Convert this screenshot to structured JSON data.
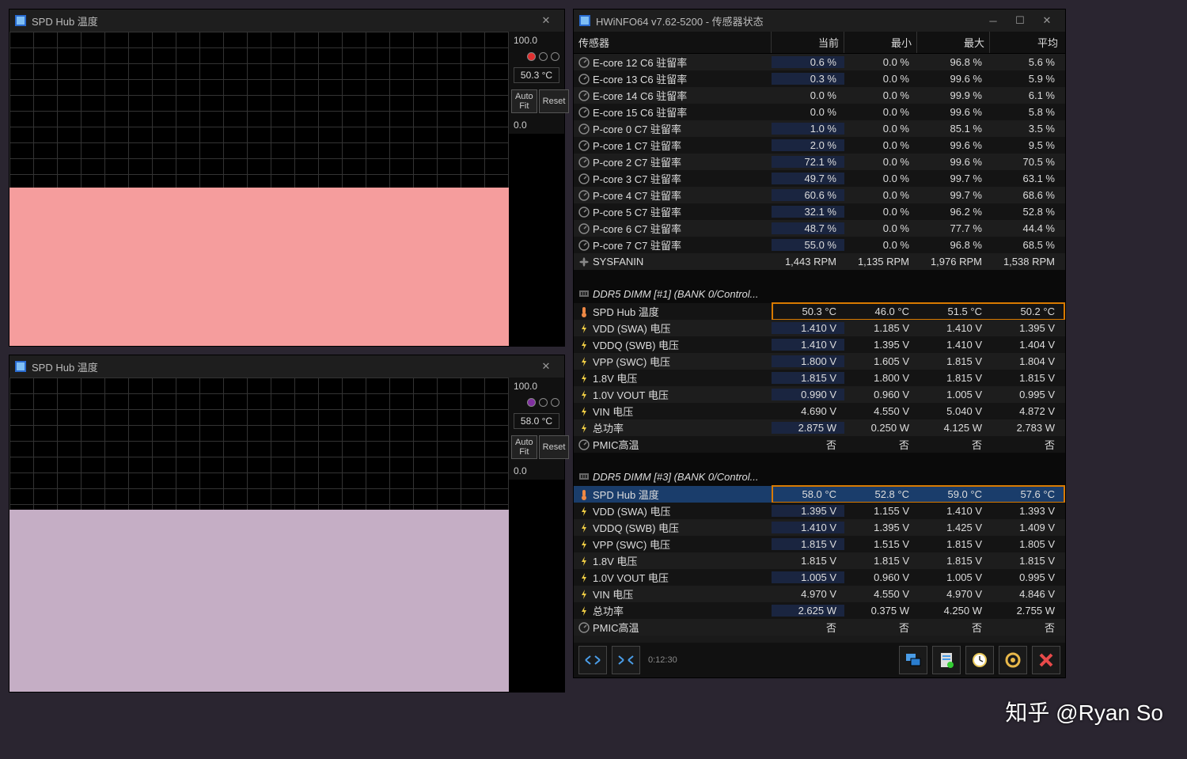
{
  "graph1": {
    "title": "SPD Hub 温度",
    "top_label": "100.0",
    "bottom_label": "0.0",
    "value": "50.3 °C",
    "color": "#f59d9d",
    "marker_color": "#e03030",
    "fill_top": "49.7%"
  },
  "graph2": {
    "title": "SPD Hub 温度",
    "top_label": "100.0",
    "bottom_label": "0.0",
    "value": "58.0 °C",
    "color": "#c5aec5",
    "marker_color": "#8030a0",
    "fill_top": "42%"
  },
  "btn_autofit": "Auto Fit",
  "btn_reset": "Reset",
  "hwinfo": {
    "title": "HWiNFO64 v7.62-5200 - 传感器状态",
    "headers": [
      "传感器",
      "当前",
      "最小",
      "最大",
      "平均"
    ],
    "rows": [
      {
        "t": "d",
        "ic": "meter",
        "name": "E-core 12 C6 驻留率",
        "v": [
          "0.6 %",
          "0.0 %",
          "96.8 %",
          "5.6 %"
        ],
        "blue": true
      },
      {
        "t": "d",
        "ic": "meter",
        "name": "E-core 13 C6 驻留率",
        "v": [
          "0.3 %",
          "0.0 %",
          "99.6 %",
          "5.9 %"
        ],
        "blue": true
      },
      {
        "t": "d",
        "ic": "meter",
        "name": "E-core 14 C6 驻留率",
        "v": [
          "0.0 %",
          "0.0 %",
          "99.9 %",
          "6.1 %"
        ]
      },
      {
        "t": "d",
        "ic": "meter",
        "name": "E-core 15 C6 驻留率",
        "v": [
          "0.0 %",
          "0.0 %",
          "99.6 %",
          "5.8 %"
        ]
      },
      {
        "t": "d",
        "ic": "meter",
        "name": "P-core 0 C7 驻留率",
        "v": [
          "1.0 %",
          "0.0 %",
          "85.1 %",
          "3.5 %"
        ],
        "blue": true
      },
      {
        "t": "d",
        "ic": "meter",
        "name": "P-core 1 C7 驻留率",
        "v": [
          "2.0 %",
          "0.0 %",
          "99.6 %",
          "9.5 %"
        ],
        "blue": true
      },
      {
        "t": "d",
        "ic": "meter",
        "name": "P-core 2 C7 驻留率",
        "v": [
          "72.1 %",
          "0.0 %",
          "99.6 %",
          "70.5 %"
        ],
        "blue": true
      },
      {
        "t": "d",
        "ic": "meter",
        "name": "P-core 3 C7 驻留率",
        "v": [
          "49.7 %",
          "0.0 %",
          "99.7 %",
          "63.1 %"
        ],
        "blue": true
      },
      {
        "t": "d",
        "ic": "meter",
        "name": "P-core 4 C7 驻留率",
        "v": [
          "60.6 %",
          "0.0 %",
          "99.7 %",
          "68.6 %"
        ],
        "blue": true
      },
      {
        "t": "d",
        "ic": "meter",
        "name": "P-core 5 C7 驻留率",
        "v": [
          "32.1 %",
          "0.0 %",
          "96.2 %",
          "52.8 %"
        ],
        "blue": true
      },
      {
        "t": "d",
        "ic": "meter",
        "name": "P-core 6 C7 驻留率",
        "v": [
          "48.7 %",
          "0.0 %",
          "77.7 %",
          "44.4 %"
        ],
        "blue": true
      },
      {
        "t": "d",
        "ic": "meter",
        "name": "P-core 7 C7 驻留率",
        "v": [
          "55.0 %",
          "0.0 %",
          "96.8 %",
          "68.5 %"
        ],
        "blue": true
      },
      {
        "t": "d",
        "ic": "fan",
        "name": "SYSFANIN",
        "v": [
          "1,443 RPM",
          "1,135 RPM",
          "1,976 RPM",
          "1,538 RPM"
        ]
      },
      {
        "t": "sp"
      },
      {
        "t": "s",
        "ic": "dimm",
        "name": "DDR5 DIMM [#1] (BANK 0/Control..."
      },
      {
        "t": "d",
        "ic": "temp",
        "name": "SPD Hub 温度",
        "v": [
          "50.3 °C",
          "46.0 °C",
          "51.5 °C",
          "50.2 °C"
        ],
        "hl": true
      },
      {
        "t": "d",
        "ic": "volt",
        "name": "VDD (SWA) 电压",
        "v": [
          "1.410 V",
          "1.185 V",
          "1.410 V",
          "1.395 V"
        ],
        "blue": true
      },
      {
        "t": "d",
        "ic": "volt",
        "name": "VDDQ (SWB) 电压",
        "v": [
          "1.410 V",
          "1.395 V",
          "1.410 V",
          "1.404 V"
        ],
        "blue": true
      },
      {
        "t": "d",
        "ic": "volt",
        "name": "VPP (SWC) 电压",
        "v": [
          "1.800 V",
          "1.605 V",
          "1.815 V",
          "1.804 V"
        ],
        "blue": true
      },
      {
        "t": "d",
        "ic": "volt",
        "name": "1.8V 电压",
        "v": [
          "1.815 V",
          "1.800 V",
          "1.815 V",
          "1.815 V"
        ],
        "blue": true
      },
      {
        "t": "d",
        "ic": "volt",
        "name": "1.0V VOUT 电压",
        "v": [
          "0.990 V",
          "0.960 V",
          "1.005 V",
          "0.995 V"
        ],
        "blue": true
      },
      {
        "t": "d",
        "ic": "volt",
        "name": "VIN 电压",
        "v": [
          "4.690 V",
          "4.550 V",
          "5.040 V",
          "4.872 V"
        ]
      },
      {
        "t": "d",
        "ic": "pow",
        "name": "总功率",
        "v": [
          "2.875 W",
          "0.250 W",
          "4.125 W",
          "2.783 W"
        ],
        "blue": true
      },
      {
        "t": "d",
        "ic": "meter",
        "name": "PMIC高温",
        "v": [
          "否",
          "否",
          "否",
          "否"
        ]
      },
      {
        "t": "sp"
      },
      {
        "t": "s",
        "ic": "dimm",
        "name": "DDR5 DIMM [#3] (BANK 0/Control..."
      },
      {
        "t": "d",
        "ic": "temp",
        "name": "SPD Hub 温度",
        "v": [
          "58.0 °C",
          "52.8 °C",
          "59.0 °C",
          "57.6 °C"
        ],
        "hl": true,
        "sel": true
      },
      {
        "t": "d",
        "ic": "volt",
        "name": "VDD (SWA) 电压",
        "v": [
          "1.395 V",
          "1.155 V",
          "1.410 V",
          "1.393 V"
        ],
        "blue": true
      },
      {
        "t": "d",
        "ic": "volt",
        "name": "VDDQ (SWB) 电压",
        "v": [
          "1.410 V",
          "1.395 V",
          "1.425 V",
          "1.409 V"
        ],
        "blue": true
      },
      {
        "t": "d",
        "ic": "volt",
        "name": "VPP (SWC) 电压",
        "v": [
          "1.815 V",
          "1.515 V",
          "1.815 V",
          "1.805 V"
        ],
        "blue": true
      },
      {
        "t": "d",
        "ic": "volt",
        "name": "1.8V 电压",
        "v": [
          "1.815 V",
          "1.815 V",
          "1.815 V",
          "1.815 V"
        ]
      },
      {
        "t": "d",
        "ic": "volt",
        "name": "1.0V VOUT 电压",
        "v": [
          "1.005 V",
          "0.960 V",
          "1.005 V",
          "0.995 V"
        ],
        "blue": true
      },
      {
        "t": "d",
        "ic": "volt",
        "name": "VIN 电压",
        "v": [
          "4.970 V",
          "4.550 V",
          "4.970 V",
          "4.846 V"
        ]
      },
      {
        "t": "d",
        "ic": "pow",
        "name": "总功率",
        "v": [
          "2.625 W",
          "0.375 W",
          "4.250 W",
          "2.755 W"
        ],
        "blue": true
      },
      {
        "t": "d",
        "ic": "meter",
        "name": "PMIC高温",
        "v": [
          "否",
          "否",
          "否",
          "否"
        ]
      }
    ],
    "timer": "0:12:30"
  },
  "watermark": "知乎 @Ryan So"
}
